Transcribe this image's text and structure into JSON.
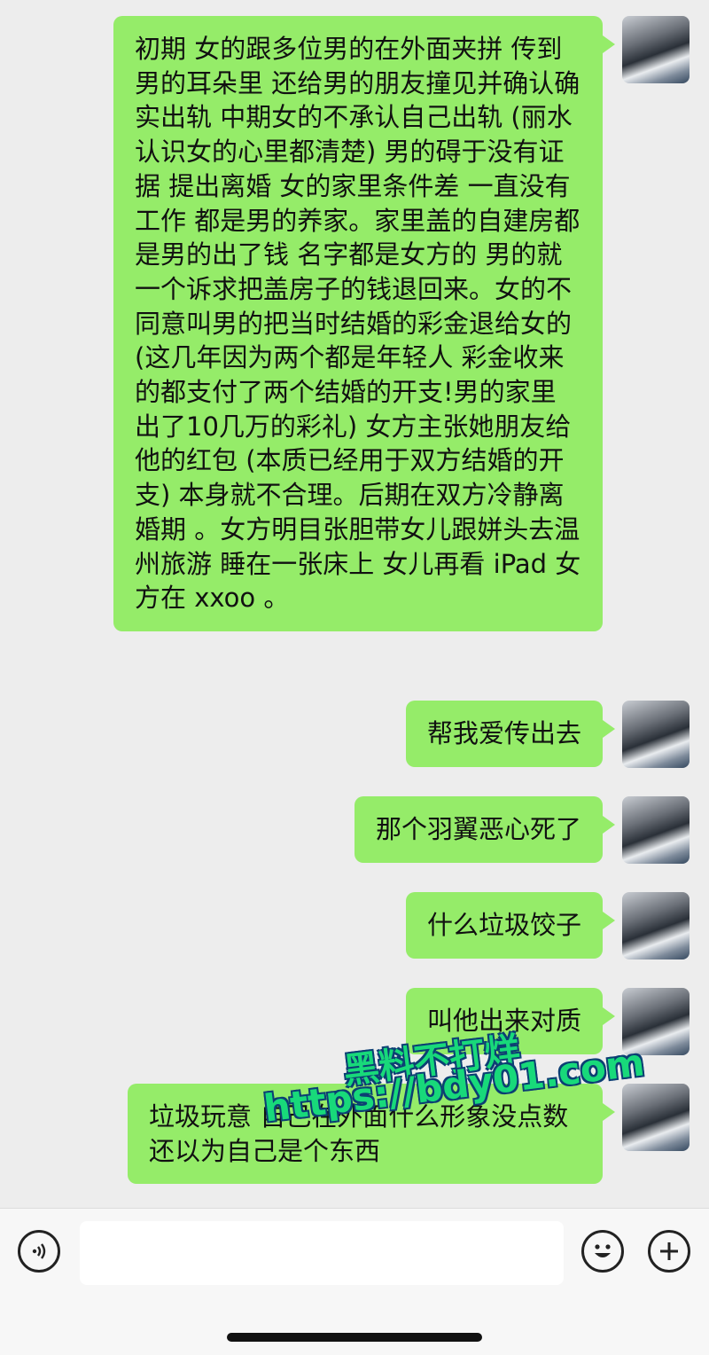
{
  "messages": [
    {
      "text": "初期 女的跟多位男的在外面夹拼 传到男的耳朵里 还给男的朋友撞见并确认确实出轨 中期女的不承认自己出轨 (丽水认识女的心里都清楚) 男的碍于没有证据 提出离婚 女的家里条件差 一直没有工作 都是男的养家。家里盖的自建房都是男的出了钱 名字都是女方的 男的就一个诉求把盖房子的钱退回来。女的不同意叫男的把当时结婚的彩金退给女的(这几年因为两个都是年轻人 彩金收来的都支付了两个结婚的开支!男的家里出了10几万的彩礼) 女方主张她朋友给他的红包 (本质已经用于双方结婚的开支) 本身就不合理。后期在双方冷静离婚期 。女方明目张胆带女儿跟姘头去温州旅游 睡在一张床上 女儿再看 iPad 女方在 xxoo 。"
    },
    {
      "text": "帮我爱传出去"
    },
    {
      "text": "那个羽翼恶心死了"
    },
    {
      "text": "什么垃圾饺子"
    },
    {
      "text": "叫他出来对质"
    },
    {
      "text": "垃圾玩意 自己在外面什么形象没点数 还以为自己是个东西"
    }
  ],
  "watermark": {
    "line1": "黑料不打烊",
    "line2": "https://bdy01.com"
  },
  "input_bar": {
    "voice_icon": "voice-icon",
    "emoji_icon": "emoji-icon",
    "plus_icon": "plus-icon",
    "input_value": ""
  },
  "colors": {
    "bubble": "#95ec69",
    "background": "#ededed",
    "watermark": "#18d97a"
  }
}
